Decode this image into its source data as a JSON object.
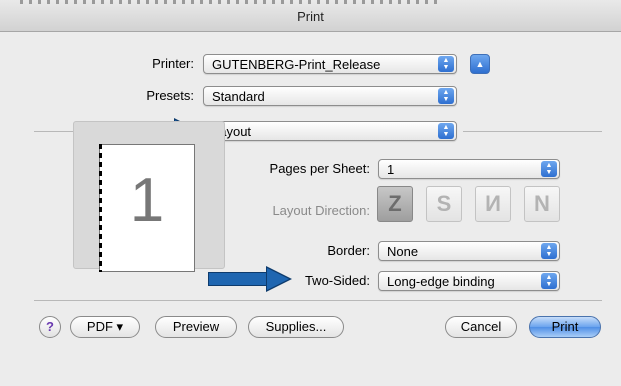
{
  "window": {
    "title": "Print"
  },
  "printer": {
    "label": "Printer:",
    "value": "GUTENBERG-Print_Release",
    "expand_glyph": "▲"
  },
  "presets": {
    "label": "Presets:",
    "value": "Standard"
  },
  "section": {
    "value": "Layout"
  },
  "preview": {
    "page_number": "1"
  },
  "layout": {
    "pages_per_sheet": {
      "label": "Pages per Sheet:",
      "value": "1"
    },
    "layout_direction": {
      "label": "Layout Direction:",
      "options": [
        {
          "glyph": "Z",
          "icon": "z-order-icon"
        },
        {
          "glyph": "S",
          "icon": "s-order-icon"
        },
        {
          "glyph": "И",
          "icon": "reverse-n-order-icon"
        },
        {
          "glyph": "N",
          "icon": "n-order-icon"
        }
      ]
    },
    "border": {
      "label": "Border:",
      "value": "None"
    },
    "two_sided": {
      "label": "Two-Sided:",
      "value": "Long-edge binding"
    }
  },
  "buttons": {
    "help": "?",
    "pdf": "PDF ▾",
    "preview": "Preview",
    "supplies": "Supplies...",
    "cancel": "Cancel",
    "print": "Print"
  },
  "colors": {
    "annotation_arrow": "#1f66b1",
    "accent": "#4f8fe6"
  }
}
